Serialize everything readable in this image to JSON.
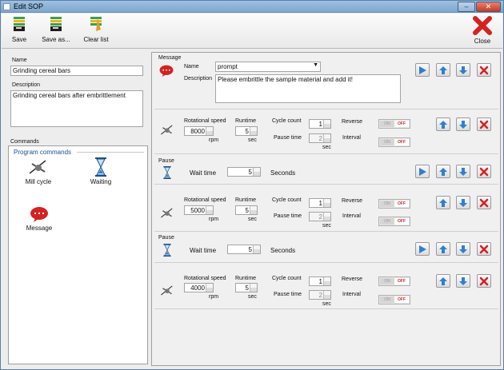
{
  "window": {
    "title": "Edit SOP",
    "minimize_label": "–",
    "close_label": "✕"
  },
  "toolbar": {
    "save": "Save",
    "save_as": "Save as...",
    "clear_list": "Clear list",
    "close": "Close"
  },
  "left": {
    "name_label": "Name",
    "name_value": "Grinding cereal bars",
    "desc_label": "Description",
    "desc_value": "Grinding cereal bars after embrittlement",
    "commands_label": "Commands",
    "program_commands": "Program commands",
    "cmd_mill": "Mill cycle",
    "cmd_wait": "Waiting",
    "cmd_message": "Message"
  },
  "message": {
    "header": "Message",
    "name_label": "Name",
    "name_value": "prompt",
    "desc_label": "Description",
    "desc_value": "Please embrittle the sample material and add it!"
  },
  "labels": {
    "rot_speed": "Rotational speed",
    "runtime": "Runtime",
    "cycle_count": "Cycle count",
    "reverse": "Reverse",
    "pause_time": "Pause time",
    "interval": "Interval",
    "rpm": "rpm",
    "sec": "sec",
    "pause": "Pause",
    "wait_time": "Wait time",
    "seconds": "Seconds",
    "on": "ON",
    "off": "OFF"
  },
  "mills": [
    {
      "speed": "8000",
      "runtime": "5",
      "cycles": "1",
      "pause": "2"
    },
    {
      "speed": "5000",
      "runtime": "5",
      "cycles": "1",
      "pause": "2"
    },
    {
      "speed": "4000",
      "runtime": "5",
      "cycles": "1",
      "pause": "2"
    }
  ],
  "pauses": [
    {
      "wait": "5"
    },
    {
      "wait": "5"
    }
  ],
  "colors": {
    "accent_blue": "#2f7fd1",
    "delete_red": "#d42222",
    "off_red": "#c62828"
  }
}
